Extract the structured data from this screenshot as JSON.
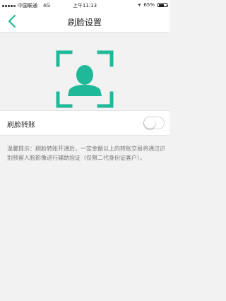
{
  "status_bar": {
    "carrier": "中国联通",
    "network": "4G",
    "time": "上午11:13",
    "battery_text": "65%",
    "battery_level": 0.65,
    "signal_bars": 5,
    "signal_filled": 4
  },
  "nav": {
    "title": "刷脸设置",
    "back_icon": "chevron-left-icon"
  },
  "hero": {
    "icon": "face-scan-icon",
    "accent_color": "#1fb99a"
  },
  "setting": {
    "label": "刷脸转账",
    "enabled": false
  },
  "tip": {
    "text": "温馨提示：刷脸转账开通后，一定金额以上的转账交易将通过识别预留人脸影像进行辅助验证（仅限二代身份证客户）。"
  }
}
